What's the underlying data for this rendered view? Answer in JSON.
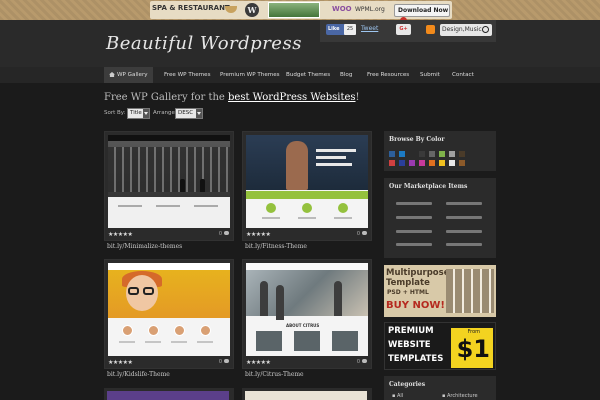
{
  "topbar": {
    "ad_spa": "SPA & RESTAURANT",
    "ad_wp": "W",
    "ad_woo": "WOO",
    "ad_wpml": "WPML.org",
    "ad_download": "Download Now"
  },
  "header": {
    "logo": "Beautiful Wordpress",
    "fb_like": "Like",
    "fb_count": "25",
    "tweet": "Tweet",
    "gplus": "G+",
    "search_value": "Design,Music"
  },
  "nav": [
    "WP Gallery",
    "Free WP Themes",
    "Premium WP Themes",
    "Budget Themes",
    "Blog",
    "Free Resources",
    "Submit",
    "Contact"
  ],
  "main": {
    "title_prefix": "Free WP Gallery for the ",
    "title_link": "best WordPress Websites",
    "title_suffix": "!",
    "sort_label": "Sort By:",
    "sort_value": "Title",
    "arrange_label": "Arrange:",
    "arrange_value": "DESC",
    "stars": "★★★★★",
    "cards": [
      {
        "caption": "bit.ly/Minimalize-themes",
        "count": "0"
      },
      {
        "caption": "bit.ly/Fitness-Theme",
        "count": "0"
      },
      {
        "caption": "bit.ly/Kidslife-Theme",
        "count": "0"
      },
      {
        "caption": "bit.ly/Citrus-Theme",
        "count": "0"
      }
    ],
    "shot_texts": {
      "citrus_about": "ABOUT CITRUS"
    }
  },
  "sidebar": {
    "browse_title": "Browse By Color",
    "colors": [
      "#2d5f9a",
      "#1c7ac2",
      "#2b2b2b",
      "#3a3a3a",
      "#666666",
      "#7fb24a",
      "#a0a0a0",
      "#4a3b29",
      "#d04040",
      "#2a3f9a",
      "#9a3ab0",
      "#c73a9a",
      "#e07020",
      "#f0c020",
      "#e8e8e8",
      "#8c5a2a"
    ],
    "marketplace_title": "Our Marketplace Items",
    "banner1": {
      "line1": "Multipurpose",
      "line2": "Template",
      "line3": "PSD + HTML",
      "line4": "BUY NOW!"
    },
    "banner2": {
      "line1": "PREMIUM",
      "line2": "WEBSITE",
      "line3": "TEMPLATES",
      "from": "From",
      "price": "$1"
    },
    "categories_title": "Categories",
    "categories": [
      "All",
      "Architecture"
    ]
  }
}
